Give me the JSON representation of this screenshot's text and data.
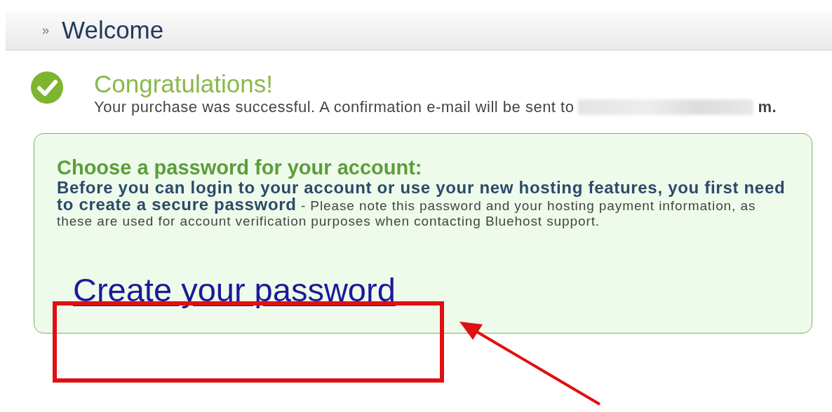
{
  "header": {
    "marker": "»",
    "title": "Welcome"
  },
  "success": {
    "title": "Congratulations!",
    "message": "Your purchase was successful. A confirmation e-mail will be sent to",
    "email_visible": "m."
  },
  "panel": {
    "heading": "Choose a password for your account:",
    "text": "**Before you can login to your account or use your new hosting features, you first need to create a secure password** - Please note this password and your hosting payment information, as these are used for account verification purposes when contacting Bluehost support.",
    "link": "Create your password"
  }
}
